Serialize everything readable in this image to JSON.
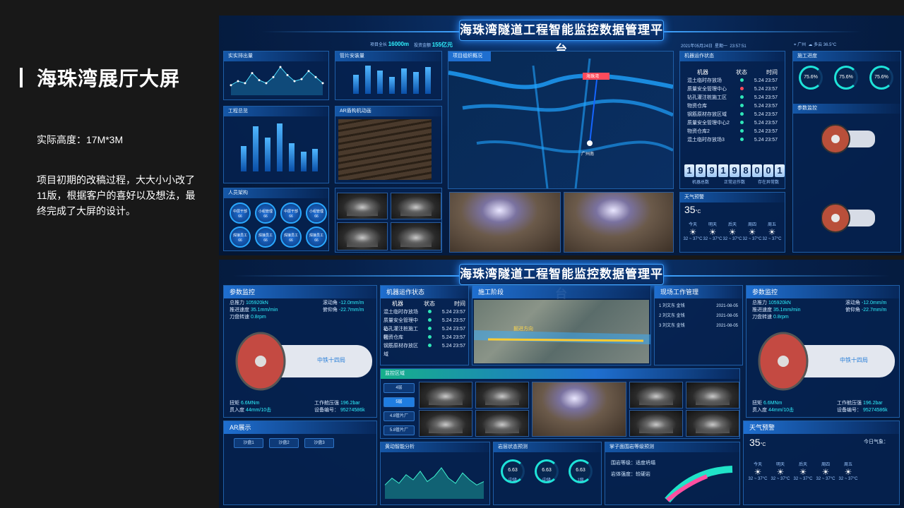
{
  "left": {
    "title": "海珠湾展厅大屏",
    "height_line": "实际高度：17M*3M",
    "description": "项目初期的改稿过程，大大小小改了11版，根据客户的喜好以及想法，最终完成了大屏的设计。"
  },
  "top_screen": {
    "title": "海珠湾隧道工程智能监控数据管理平台",
    "datetime": "2021年05月24日",
    "weekday": "星期一",
    "time": "23:57:51",
    "city": "广州",
    "weather_now": "多云",
    "temp_now": "36.5°C",
    "stat1_label": "项目全长",
    "stat1_value": "16000m",
    "stat2_label": "投资金额",
    "stat2_value": "155亿元",
    "panels": {
      "p1": "实实排出量",
      "p2": "管片安装量",
      "p3": "项目组织概况",
      "p4": "工程总览",
      "p5": "AR盾构机动画",
      "p6": "人员架构",
      "p7": "机器运作状态",
      "p8": "施工进度",
      "p9": "参数监控",
      "p10": "天气预警"
    },
    "people": [
      {
        "role": "中层干部",
        "count": "66"
      },
      {
        "role": "小组管理",
        "count": "66"
      },
      {
        "role": "中层干部",
        "count": "66"
      },
      {
        "role": "小组管理",
        "count": "66"
      },
      {
        "role": "焊接员工",
        "count": "66"
      },
      {
        "role": "焊接员工",
        "count": "66"
      },
      {
        "role": "焊接员工",
        "count": "66"
      },
      {
        "role": "焊接员工",
        "count": "66"
      }
    ],
    "machines": {
      "headers": [
        "机器",
        "状态",
        "时间"
      ],
      "rows": [
        {
          "name": "混土临时存放场",
          "time": "5.24  23:57",
          "status": "ok"
        },
        {
          "name": "质量安全管理中心",
          "time": "5.24  23:57",
          "status": "warn"
        },
        {
          "name": "钻孔灌注桩施工区",
          "time": "5.24  23:57",
          "status": "ok"
        },
        {
          "name": "物资仓库",
          "time": "5.24  23:57",
          "status": "ok"
        },
        {
          "name": "钢筋原材存放区域",
          "time": "5.24  23:57",
          "status": "ok"
        },
        {
          "name": "质量安全管理中心2",
          "time": "5.24  23:57",
          "status": "ok"
        },
        {
          "name": "物资仓库2",
          "time": "5.24  23:57",
          "status": "ok"
        },
        {
          "name": "混土临时存放场3",
          "time": "5.24  23:57",
          "status": "ok"
        }
      ]
    },
    "counters": [
      {
        "value": "199",
        "label": "机器总数"
      },
      {
        "value": "198",
        "label": "正常运作数"
      },
      {
        "value": "001",
        "label": "存在异常数"
      }
    ],
    "progress": [
      {
        "value": "75.6%"
      },
      {
        "value": "75.6%"
      },
      {
        "value": "75.6%"
      }
    ],
    "weather_temp": "35",
    "weather_unit": "°C",
    "forecast_days": [
      "今天",
      "明天",
      "后天",
      "周四",
      "周五"
    ],
    "forecast_temp": "32 ~ 37°C",
    "map_labels": [
      "海珠湾",
      "广州南"
    ]
  },
  "bottom_screen": {
    "title": "海珠湾隧道工程智能监控数据管理平台",
    "panels": {
      "param_left": "参数监控",
      "machine_status": "机器运作状态",
      "construction": "施工阶段",
      "onsite": "现场工作管理",
      "param_right": "参数监控",
      "ar": "AR展示",
      "monitor": "监控区域",
      "settle": "黄动智能分析",
      "rock": "岩层状态预测",
      "face": "掌子面围岩等级预测",
      "weather": "天气预警"
    },
    "params_left": [
      {
        "k": "总推力",
        "v": "105920kN"
      },
      {
        "k": "推进速度",
        "v": "35.1mm/min"
      },
      {
        "k": "刀盘转速",
        "v": "0.8rpm"
      }
    ],
    "params_left_2": [
      {
        "k": "滚动角",
        "v": "-12.0mm/m"
      },
      {
        "k": "俯仰角",
        "v": "-22.7mm/m"
      }
    ],
    "params_left_foot": [
      {
        "k": "扭矩",
        "v": "6.6MNm"
      },
      {
        "k": "贯入度",
        "v": "44mm/10击"
      }
    ],
    "params_left_foot2": [
      {
        "k": "工作舱压强",
        "v": "196.2bar"
      },
      {
        "k": "设备编号：",
        "v": "95274586k"
      }
    ],
    "machine_headers": [
      "机器",
      "状态",
      "时间"
    ],
    "machine_rows": [
      {
        "name": "混土临时存放场",
        "time": "5.24  23:57"
      },
      {
        "name": "质量安全管理中心",
        "time": "5.24  23:57"
      },
      {
        "name": "钻孔灌注桩施工区",
        "time": "5.24  23:57"
      },
      {
        "name": "物资仓库",
        "time": "5.24  23:57"
      },
      {
        "name": "钢筋原材存放区域",
        "time": "5.24  23:57"
      }
    ],
    "onsite_rows": [
      {
        "name": "1 刘文东 金钱",
        "date": "2021-08-05"
      },
      {
        "name": "2 刘文东 金钱",
        "date": "2021-08-05"
      },
      {
        "name": "3 刘文东 金钱",
        "date": "2021-08-05"
      }
    ],
    "direction_label": "掘进方向",
    "monitor_tabs": [
      "4层",
      "5层",
      "4.8管片厂",
      "5.8管片厂"
    ],
    "ar_tabs": [
      "沙盘1",
      "沙盘2",
      "沙盘3"
    ],
    "rock_values": [
      "6.63",
      "6.63",
      "6.63"
    ],
    "rock_labels": [
      "中级",
      "中级",
      "1级"
    ],
    "face_labels": [
      "围岩等级：适度坍塌",
      "岩体强度：较硬岩"
    ],
    "weather_temp": "35",
    "weather_unit": "°C",
    "weather_today": "今日气象：",
    "settle_chart": [
      8,
      12,
      9,
      14,
      11,
      16,
      10,
      13,
      18,
      12,
      9,
      15,
      11,
      8,
      10
    ],
    "drill_label": "中铁十四局"
  },
  "charts": {
    "discharge_line": [
      10,
      14,
      12,
      22,
      15,
      12,
      18,
      28,
      20,
      14,
      16,
      24,
      18,
      12
    ],
    "segment_bars": [
      60,
      90,
      75,
      55,
      80,
      70,
      85
    ],
    "overview_bars": [
      45,
      80,
      60,
      85,
      50,
      35,
      40
    ]
  }
}
